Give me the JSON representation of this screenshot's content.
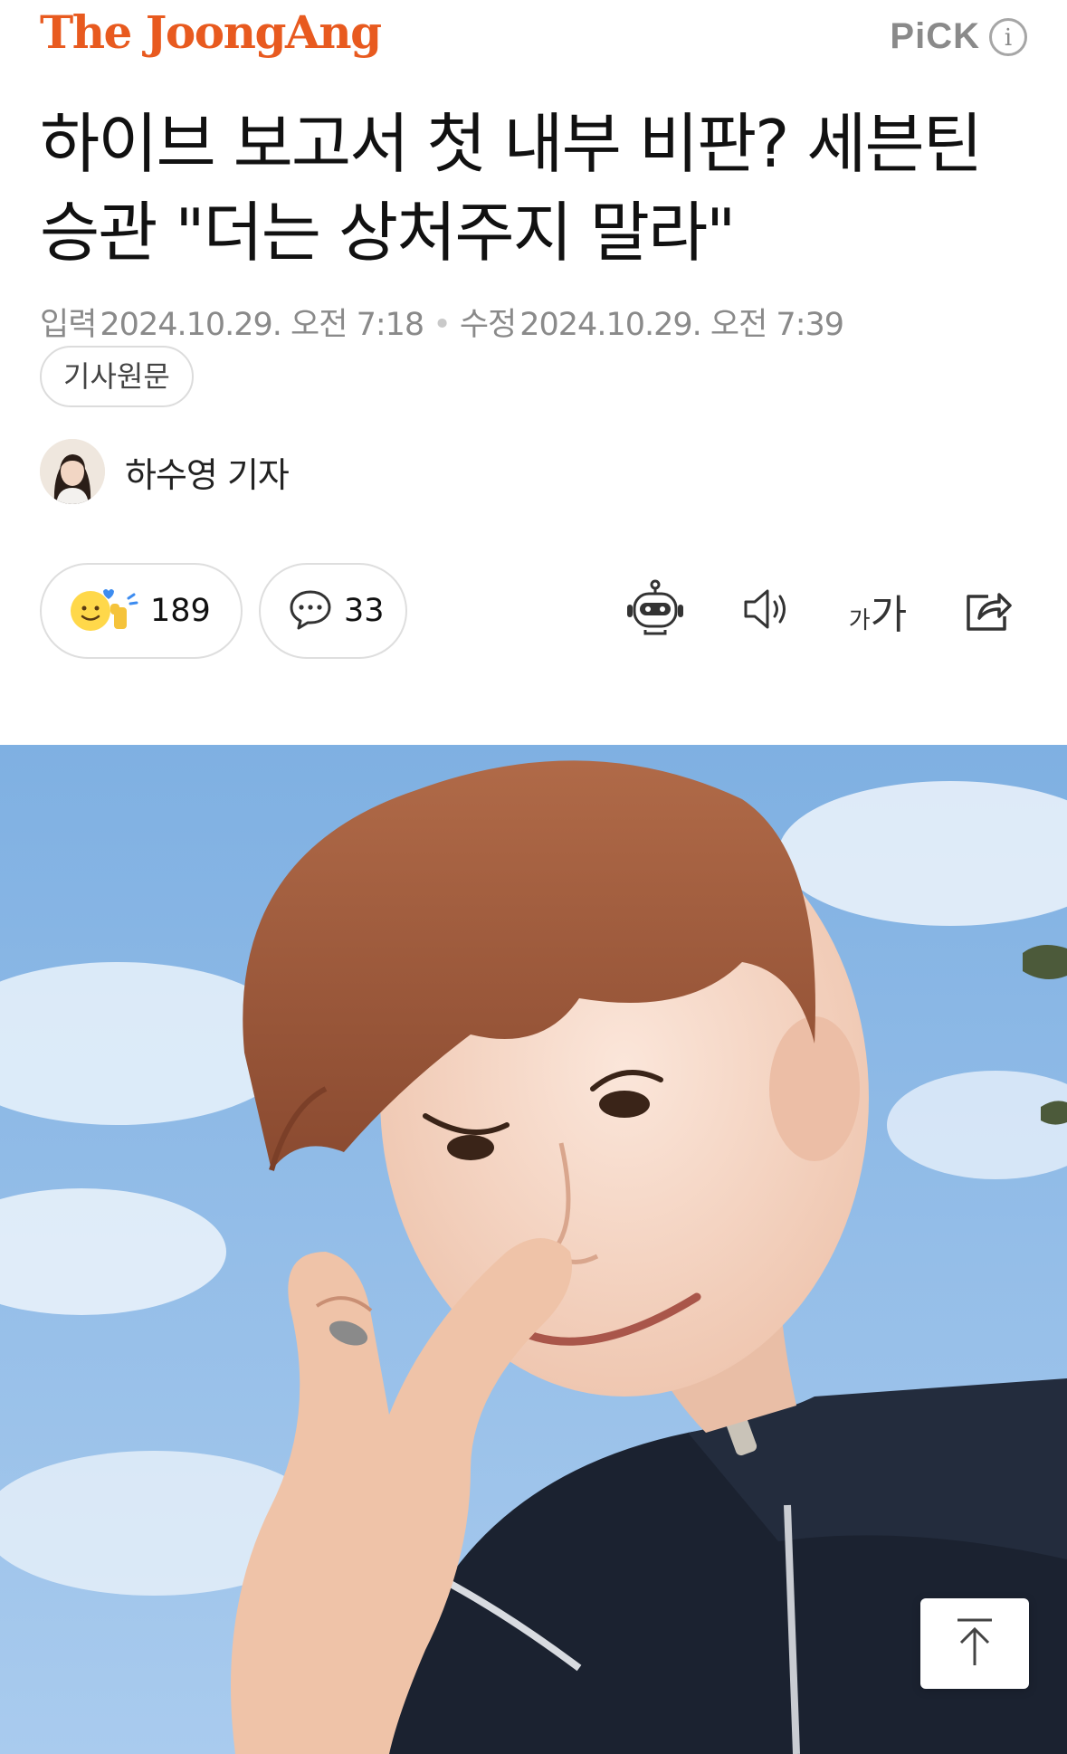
{
  "header": {
    "logo_text": "The JoongAng",
    "logo_color": "#e85a1f",
    "pick_label": "PiCK"
  },
  "article": {
    "title": "하이브 보고서 첫 내부 비판? 세븐틴 승관 \"더는 상처주지 말라\"",
    "input_label": "입력",
    "input_date": "2024.10.29. 오전 7:18",
    "edit_label": "수정",
    "edit_date": "2024.10.29. 오전 7:39",
    "original_button": "기사원문"
  },
  "author": {
    "name": "하수영 기자"
  },
  "reactions": {
    "like_count": "189",
    "comment_count": "33"
  },
  "toolbar": {
    "font_small": "가",
    "font_large": "가"
  },
  "icons": [
    "info-icon",
    "reaction-emoji-icon",
    "comment-icon",
    "summary-bot-icon",
    "audio-speaker-icon",
    "font-size-icon",
    "share-icon",
    "arrow-up-icon"
  ]
}
